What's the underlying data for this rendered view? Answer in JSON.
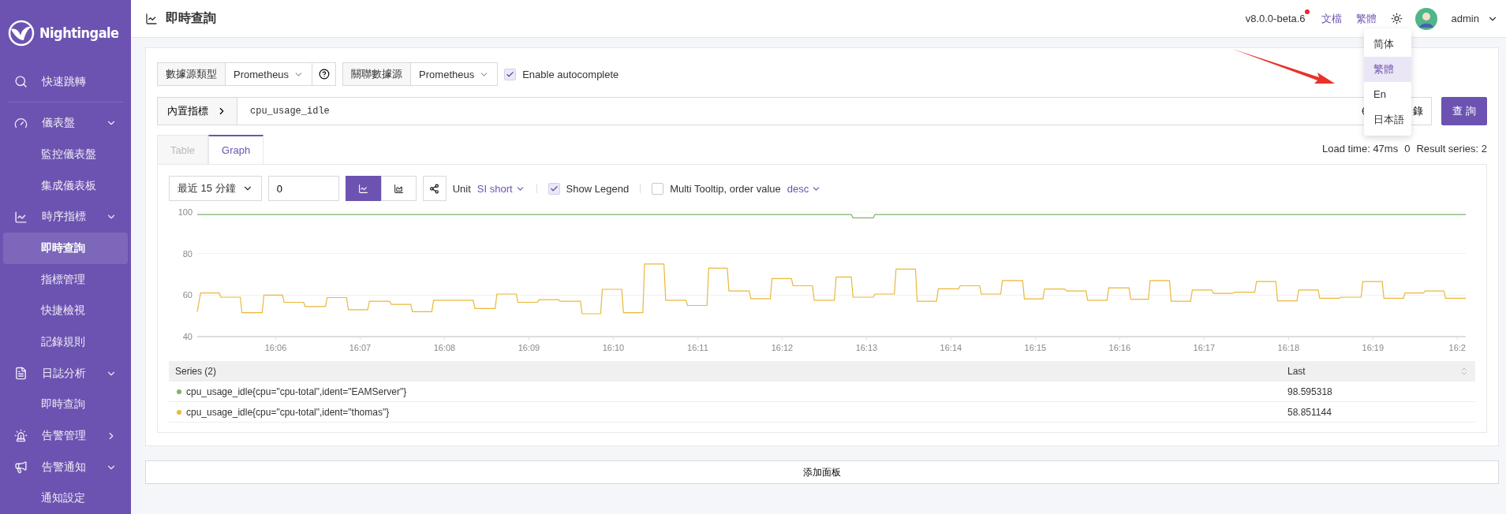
{
  "sidebar": {
    "logo": "Nightingale",
    "items": [
      {
        "label": "快速跳轉",
        "selected": false
      },
      {
        "label": "儀表盤",
        "selected": false,
        "expanded": true,
        "children": [
          {
            "label": "監控儀表盤",
            "selected": false
          },
          {
            "label": "集成儀表板",
            "selected": false
          }
        ]
      },
      {
        "label": "時序指標",
        "selected": false,
        "expanded": true,
        "children": [
          {
            "label": "即時查詢",
            "selected": true
          },
          {
            "label": "指標管理",
            "selected": false
          },
          {
            "label": "快捷檢視",
            "selected": false
          },
          {
            "label": "記錄規則",
            "selected": false
          }
        ]
      },
      {
        "label": "日誌分析",
        "selected": false,
        "expanded": true,
        "children": [
          {
            "label": "即時查詢",
            "selected": false
          }
        ]
      },
      {
        "label": "告警管理",
        "selected": false,
        "expanded": false
      },
      {
        "label": "告警通知",
        "selected": false,
        "expanded": true,
        "children": [
          {
            "label": "通知設定",
            "selected": false
          }
        ]
      }
    ]
  },
  "header": {
    "title": "即時查詢",
    "version": "v8.0.0-beta.6",
    "update_dot": true,
    "links": [
      "文檔",
      "繁體"
    ],
    "user": "admin",
    "language_menu": [
      {
        "label": "简体",
        "selected": false
      },
      {
        "label": "繁體",
        "selected": true
      },
      {
        "label": "En",
        "selected": false
      },
      {
        "label": "日本語",
        "selected": false
      }
    ]
  },
  "query": {
    "datasource_type_label": "數據源類型",
    "datasource_type": "Prometheus",
    "datasource_label": "關聯數據源",
    "datasource": "Prometheus",
    "autocomplete": {
      "label": "Enable autocomplete",
      "checked": true
    },
    "metrics_button": "內置指標",
    "query": "cpu_usage_idle",
    "history_button": "錄",
    "run_button": "查 詢"
  },
  "tabs": [
    {
      "label": "Table",
      "selected": false
    },
    {
      "label": "Graph",
      "selected": true
    }
  ],
  "stats": [
    "Load time: 47ms",
    "0",
    "Result series: 2"
  ],
  "graph": {
    "time_range": "最近 15 分鐘",
    "step": "0",
    "chart_types": [
      {
        "kind": "line",
        "selected": true
      },
      {
        "kind": "area",
        "selected": false
      }
    ],
    "unit_label": "Unit",
    "unit": "SI short",
    "show_legend": {
      "label": "Show Legend",
      "checked": true
    },
    "multi_tooltip": {
      "label": "Multi Tooltip, order value",
      "checked": false
    },
    "order": "desc",
    "chart_data": {
      "type": "line",
      "xlim": [
        965.07,
        980.1
      ],
      "ylim": [
        40,
        100
      ],
      "yticks": [
        40,
        60,
        80,
        100
      ],
      "xticks": [
        {
          "value": 966,
          "label": "16:06"
        },
        {
          "value": 967,
          "label": "16:07"
        },
        {
          "value": 968,
          "label": "16:08"
        },
        {
          "value": 969,
          "label": "16:09"
        },
        {
          "value": 970,
          "label": "16:10"
        },
        {
          "value": 971,
          "label": "16:11"
        },
        {
          "value": 972,
          "label": "16:12"
        },
        {
          "value": 973,
          "label": "16:13"
        },
        {
          "value": 974,
          "label": "16:14"
        },
        {
          "value": 975,
          "label": "16:15"
        },
        {
          "value": 976,
          "label": "16:16"
        },
        {
          "value": 977,
          "label": "16:17"
        },
        {
          "value": 978,
          "label": "16:18"
        },
        {
          "value": 979,
          "label": "16:19"
        },
        {
          "value": 980,
          "label": "16:2"
        }
      ],
      "x": [
        965.07,
        965.11,
        965.33,
        965.35,
        965.58,
        965.6,
        965.84,
        965.86,
        966.08,
        966.1,
        966.33,
        966.35,
        966.59,
        966.61,
        966.84,
        966.86,
        967.09,
        967.11,
        967.35,
        967.37,
        967.6,
        967.62,
        967.85,
        967.87,
        968.34,
        968.36,
        968.6,
        968.62,
        968.85,
        968.87,
        969.1,
        969.12,
        969.35,
        969.37,
        969.61,
        969.63,
        969.85,
        969.87,
        970.1,
        970.12,
        970.35,
        970.37,
        970.6,
        970.62,
        970.86,
        970.88,
        971.11,
        971.13,
        971.35,
        971.37,
        971.61,
        971.63,
        971.86,
        971.88,
        972.11,
        972.13,
        972.36,
        972.38,
        972.62,
        972.64,
        972.82,
        972.84,
        973.08,
        973.1,
        973.33,
        973.35,
        973.58,
        973.6,
        973.83,
        973.85,
        974.09,
        974.11,
        974.34,
        974.36,
        974.59,
        974.61,
        974.85,
        974.87,
        975.09,
        975.11,
        975.35,
        975.37,
        975.6,
        975.62,
        975.85,
        975.87,
        976.11,
        976.13,
        976.34,
        976.36,
        976.59,
        976.61,
        976.84,
        976.86,
        977.09,
        977.11,
        977.34,
        977.36,
        977.6,
        977.62,
        977.85,
        977.87,
        978.1,
        978.12,
        978.35,
        978.37,
        978.6,
        978.62,
        978.86,
        978.88,
        979.11,
        979.13,
        979.36,
        979.38,
        979.6,
        979.62,
        979.84,
        979.86,
        980.1
      ],
      "series": [
        {
          "color": "#7eb26d",
          "values": [
            98.8,
            98.8,
            98.8,
            98.8,
            98.8,
            98.8,
            98.8,
            98.8,
            98.8,
            98.8,
            98.8,
            98.8,
            98.8,
            98.8,
            98.8,
            98.8,
            98.8,
            98.8,
            98.8,
            98.8,
            98.8,
            98.8,
            98.8,
            98.8,
            98.8,
            98.8,
            98.8,
            98.8,
            98.8,
            98.8,
            98.8,
            98.8,
            98.8,
            98.8,
            98.8,
            98.8,
            98.8,
            98.8,
            98.8,
            98.8,
            98.8,
            98.8,
            98.8,
            98.8,
            98.8,
            98.8,
            98.8,
            98.8,
            98.8,
            98.8,
            98.8,
            98.8,
            98.8,
            98.8,
            98.8,
            98.8,
            98.8,
            98.8,
            98.8,
            98.8,
            98.8,
            97.2,
            97.2,
            98.8,
            98.8,
            98.8,
            98.8,
            98.8,
            98.8,
            98.8,
            98.8,
            98.8,
            98.8,
            98.8,
            98.8,
            98.8,
            98.8,
            98.8,
            98.8,
            98.8,
            98.8,
            98.8,
            98.8,
            98.8,
            98.8,
            98.8,
            98.8,
            98.8,
            98.8,
            98.8,
            98.8,
            98.8,
            98.8,
            98.8,
            98.8,
            98.8,
            98.8,
            98.8,
            98.8,
            98.8,
            98.8,
            98.8,
            98.8,
            98.8,
            98.8,
            98.8,
            98.8,
            98.8,
            98.8,
            98.8,
            98.8,
            98.8,
            98.8,
            98.8,
            98.8,
            98.8,
            98.8,
            98.8,
            98.8
          ]
        },
        {
          "color": "#eab839",
          "values": [
            52,
            61,
            61,
            59,
            59,
            51.5,
            51.5,
            60,
            60,
            56.5,
            56.5,
            54.5,
            54.5,
            58.8,
            58.8,
            53,
            53,
            57,
            57,
            55.5,
            55.5,
            52,
            52,
            57.5,
            57.5,
            53.5,
            53.5,
            60.5,
            60.5,
            56.5,
            56.5,
            57.8,
            57.8,
            57,
            57,
            51,
            51,
            62.8,
            62.8,
            51.5,
            51.5,
            75,
            75,
            57.5,
            57.5,
            55,
            55,
            73,
            73,
            62,
            62,
            58.3,
            58.3,
            68,
            68,
            64.5,
            64.5,
            57.5,
            57.5,
            68.7,
            68.7,
            59,
            59,
            60.5,
            60.5,
            72.5,
            72.5,
            57,
            57,
            63,
            63,
            64.5,
            64.5,
            60.5,
            60.5,
            67,
            67,
            58.2,
            58.2,
            62.9,
            62.9,
            62,
            62,
            57.5,
            57.5,
            63.5,
            63.5,
            58,
            58,
            67,
            67,
            57,
            57,
            62.5,
            62.5,
            60.8,
            60.8,
            61.4,
            61.4,
            66.5,
            66.5,
            57.2,
            57.2,
            62.5,
            62.5,
            58.5,
            58.5,
            59,
            59,
            66.5,
            66.5,
            58.5,
            58.5,
            61,
            61,
            62,
            62,
            58.5,
            58.5
          ]
        }
      ]
    },
    "legend": {
      "columns": [
        "Series (2)",
        "Last"
      ],
      "rows": [
        {
          "name": "cpu_usage_idle{cpu=\"cpu-total\",ident=\"EAMServer\"}",
          "color": "#7eb26d",
          "last": "98.595318"
        },
        {
          "name": "cpu_usage_idle{cpu=\"cpu-total\",ident=\"thomas\"}",
          "color": "#eab839",
          "last": "58.851144"
        }
      ]
    }
  },
  "add_panel": "添加面板"
}
